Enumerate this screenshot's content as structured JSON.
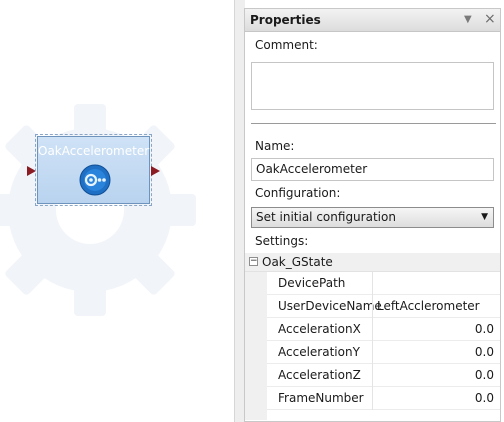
{
  "canvas": {
    "node": {
      "title": "OakAccelerometer",
      "icon": "oak-sensor-icon"
    }
  },
  "properties": {
    "title": "Properties",
    "pin_icon": "pin-dropdown-icon",
    "close_icon": "close-icon",
    "comment_label": "Comment:",
    "comment_value": "",
    "name_label": "Name:",
    "name_value": "OakAccelerometer",
    "configuration_label": "Configuration:",
    "configuration_value": "Set initial configuration",
    "settings_label": "Settings:",
    "group": {
      "toggle": "⊟",
      "name": "Oak_GState",
      "rows": [
        {
          "name": "DevicePath",
          "value": ""
        },
        {
          "name": "UserDeviceName",
          "value": "LeftAcclerometer"
        },
        {
          "name": "AccelerationX",
          "value": "0.0"
        },
        {
          "name": "AccelerationY",
          "value": "0.0"
        },
        {
          "name": "AccelerationZ",
          "value": "0.0"
        },
        {
          "name": "FrameNumber",
          "value": "0.0"
        }
      ]
    }
  },
  "colors": {
    "node_fill": "#b9d3ef",
    "port": "#8b1c24",
    "icon_blue": "#1f6fc4"
  }
}
